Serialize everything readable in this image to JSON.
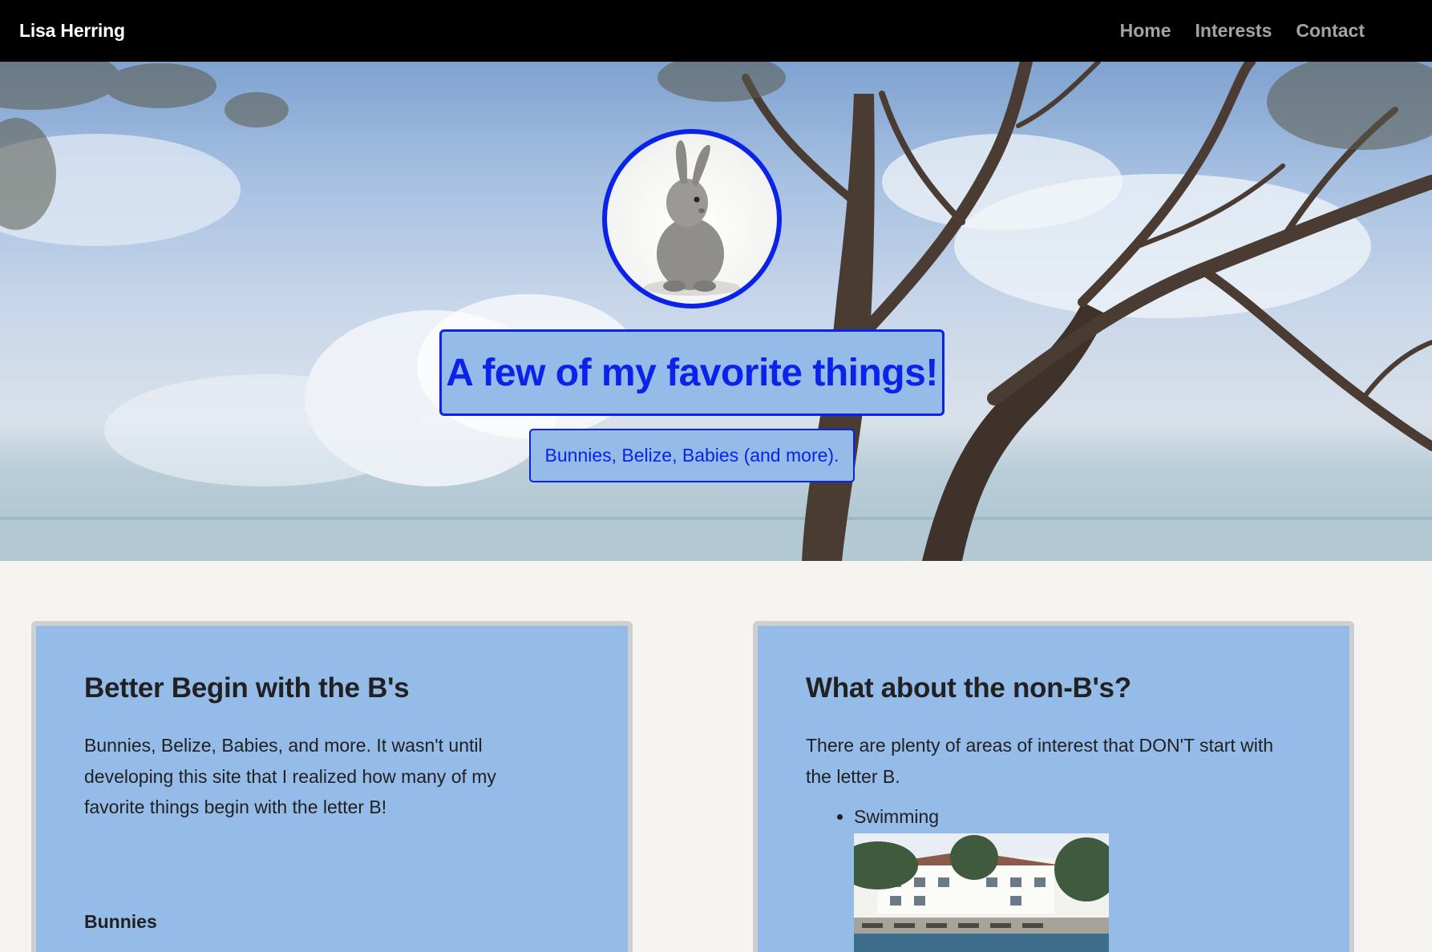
{
  "navbar": {
    "brand": "Lisa Herring",
    "links": [
      {
        "label": "Home"
      },
      {
        "label": "Interests"
      },
      {
        "label": "Contact"
      }
    ]
  },
  "hero": {
    "title": "A few of my favorite things!",
    "subtitle": "Bunnies, Belize, Babies (and more).",
    "accent_color": "#0b23e8",
    "box_color": "#95bbe9"
  },
  "cards": {
    "left": {
      "heading": "Better Begin with the B's",
      "body": "Bunnies, Belize, Babies, and more. It wasn't until developing this site that I realized how many of my favorite things begin with the letter B!",
      "subheading": "Bunnies"
    },
    "right": {
      "heading": "What about the non-B's?",
      "body": "There are plenty of areas of interest that DON'T start with the letter B.",
      "list": [
        "Swimming"
      ]
    }
  }
}
